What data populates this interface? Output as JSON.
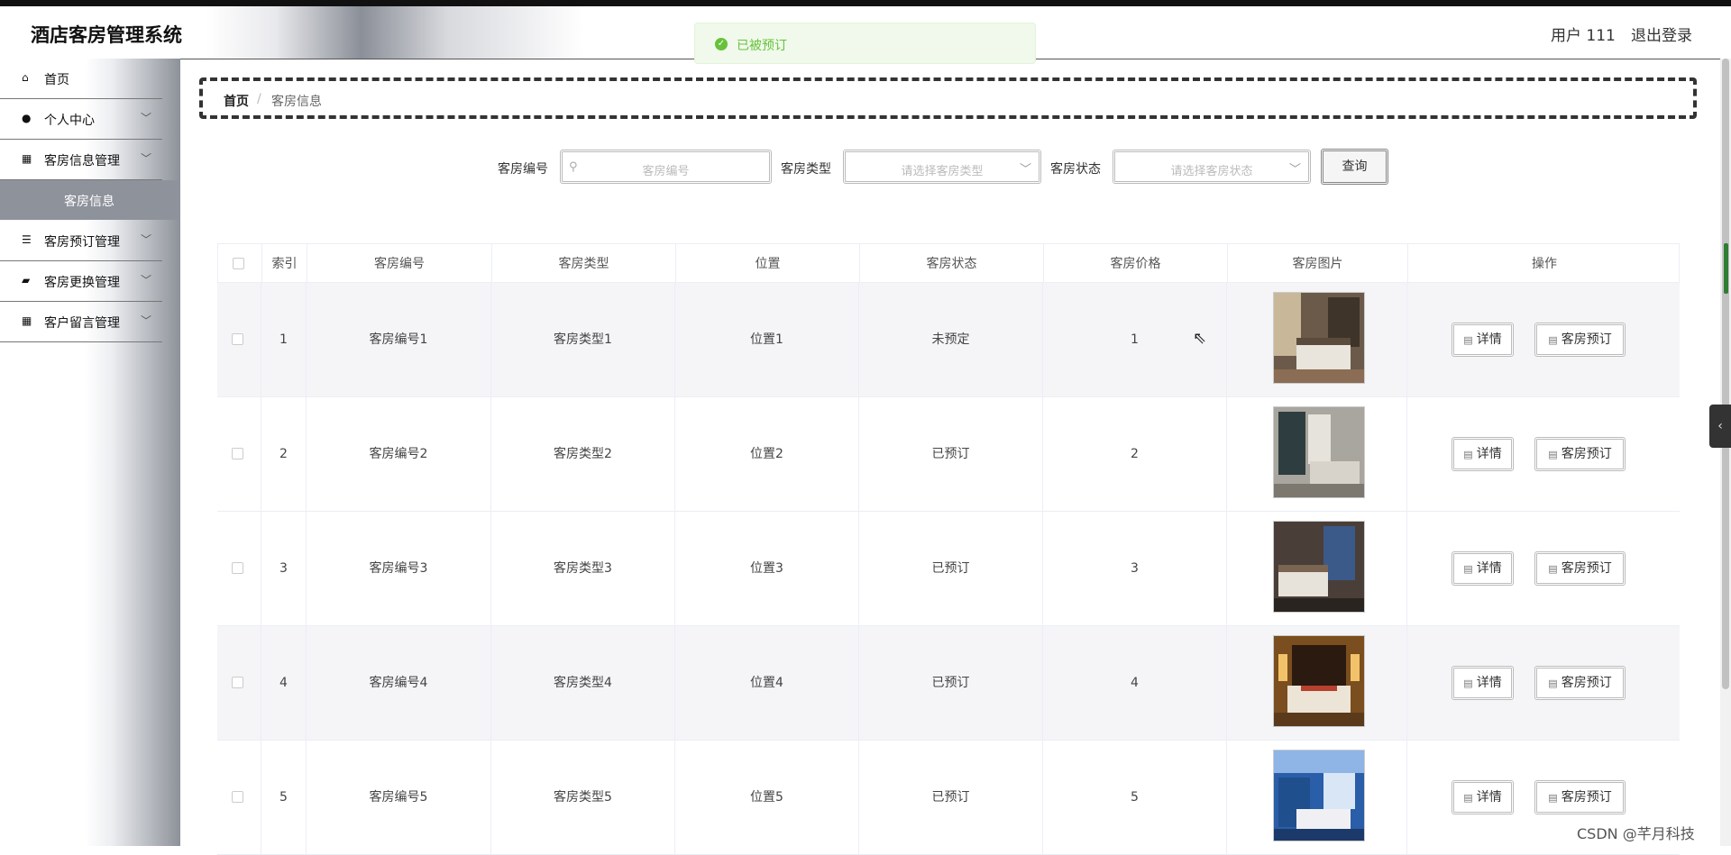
{
  "header": {
    "app_title": "酒店客房管理系统",
    "user_label": "用户 111",
    "logout_label": "退出登录"
  },
  "toast": {
    "message": "已被预订",
    "icon": "check-circle-icon",
    "color": "#67c23a"
  },
  "sidebar": {
    "items": [
      {
        "label": "首页",
        "icon": "home-icon",
        "has_arrow": false
      },
      {
        "label": "个人中心",
        "icon": "user-icon",
        "has_arrow": true
      },
      {
        "label": "客房信息管理",
        "icon": "grid-icon",
        "has_arrow": true
      },
      {
        "label": "客房预订管理",
        "icon": "sliders-icon",
        "has_arrow": true
      },
      {
        "label": "客房更换管理",
        "icon": "briefcase-icon",
        "has_arrow": true
      },
      {
        "label": "客户留言管理",
        "icon": "grid-icon",
        "has_arrow": true
      }
    ],
    "active_sub": "客房信息"
  },
  "breadcrumb": {
    "home": "首页",
    "separator": "/",
    "current": "客房信息"
  },
  "filters": {
    "room_no_label": "客房编号",
    "room_no_placeholder": "客房编号",
    "room_type_label": "客房类型",
    "room_type_placeholder": "请选择客房类型",
    "room_status_label": "客房状态",
    "room_status_placeholder": "请选择客房状态",
    "query_label": "查询"
  },
  "table": {
    "headers": [
      "索引",
      "客房编号",
      "客房类型",
      "位置",
      "客房状态",
      "客房价格",
      "客房图片",
      "操作"
    ],
    "rows": [
      {
        "index": "1",
        "room_no": "客房编号1",
        "room_type": "客房类型1",
        "location": "位置1",
        "status": "未预定",
        "price": "1"
      },
      {
        "index": "2",
        "room_no": "客房编号2",
        "room_type": "客房类型2",
        "location": "位置2",
        "status": "已预订",
        "price": "2"
      },
      {
        "index": "3",
        "room_no": "客房编号3",
        "room_type": "客房类型3",
        "location": "位置3",
        "status": "已预订",
        "price": "3"
      },
      {
        "index": "4",
        "room_no": "客房编号4",
        "room_type": "客房类型4",
        "location": "位置4",
        "status": "已预订",
        "price": "4"
      },
      {
        "index": "5",
        "room_no": "客房编号5",
        "room_type": "客房类型5",
        "location": "位置5",
        "status": "已预订",
        "price": "5"
      }
    ],
    "detail_label": "详情",
    "book_label": "客房预订"
  },
  "watermark": "CSDN @芊月科技"
}
